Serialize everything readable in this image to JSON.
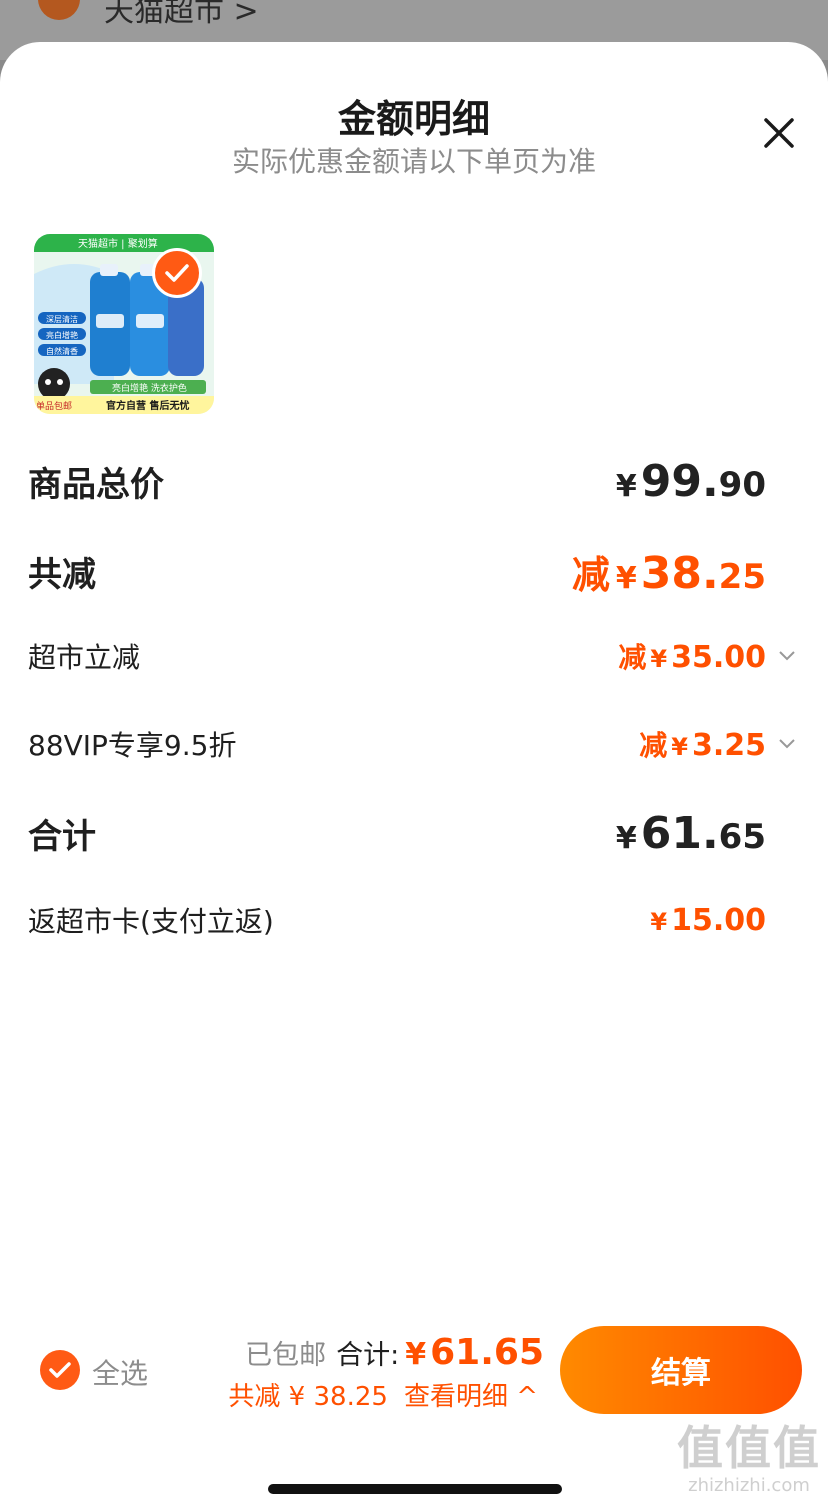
{
  "background": {
    "shop_name": "天猫超市 >"
  },
  "sheet": {
    "title": "金额明细",
    "subtitle": "实际优惠金额请以下单页为准"
  },
  "product": {
    "image_top_brand": "天猫超市 | 聚划算",
    "bullets": [
      "深层清洁",
      "亮白增艳",
      "自然清香"
    ],
    "tagline": "亮白增艳 洗衣护色",
    "footer": "官方自营 售后无忧",
    "corner_tag": "单品包邮",
    "selected": true
  },
  "rows": {
    "goods_total": {
      "label": "商品总价",
      "yen": "¥",
      "int": "99.",
      "dec": "90"
    },
    "total_discount": {
      "label": "共减",
      "prefix": "减",
      "yen": "¥",
      "int": "38.",
      "dec": "25"
    },
    "supermarket_discount": {
      "label": "超市立减",
      "prefix": "减",
      "yen": "¥",
      "int": "35.",
      "dec": "00"
    },
    "vip_discount": {
      "label": "88VIP专享9.5折",
      "prefix": "减",
      "yen": "¥",
      "int": "3.",
      "dec": "25"
    },
    "subtotal": {
      "label": "合计",
      "yen": "¥",
      "int": "61.",
      "dec": "65"
    },
    "cashback": {
      "label": "返超市卡(支付立返)",
      "yen": "¥",
      "int": "15.",
      "dec": "00"
    }
  },
  "bottom_bar": {
    "select_all": "全选",
    "shipping": "已包邮",
    "total_label": "合计:",
    "total_yen": "¥",
    "total_value": "61.65",
    "saving": "共减 ¥ 38.25",
    "view_detail": "查看明细 ^",
    "checkout": "结算"
  },
  "watermark": {
    "big": "值值值",
    "small": "zhizhizhi.com"
  },
  "colors": {
    "accent": "#ff5000",
    "checkout_gradient_start": "#ff8a00",
    "muted": "#8c8c8c"
  }
}
